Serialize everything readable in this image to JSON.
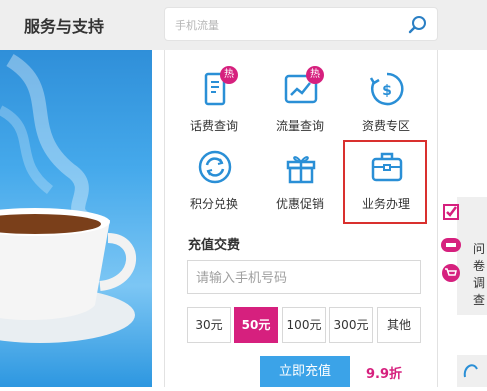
{
  "header": {
    "title": "服务与支持",
    "search_placeholder": "手机流量"
  },
  "services": [
    {
      "label": "话费查询",
      "badge": "热",
      "icon": "phone-bill-icon"
    },
    {
      "label": "流量查询",
      "badge": "热",
      "icon": "data-chart-icon"
    },
    {
      "label": "资费专区",
      "badge": "",
      "icon": "tariff-icon"
    },
    {
      "label": "积分兑换",
      "badge": "",
      "icon": "points-exchange-icon"
    },
    {
      "label": "优惠促销",
      "badge": "",
      "icon": "gift-icon"
    },
    {
      "label": "业务办理",
      "badge": "",
      "icon": "briefcase-icon"
    }
  ],
  "recharge": {
    "title": "充值交费",
    "phone_placeholder": "请输入手机号码",
    "amounts": [
      "30元",
      "50元",
      "100元",
      "300元",
      "其他"
    ],
    "selected": "50元",
    "submit_label": "立即充值",
    "discount": "9.9折"
  },
  "side_panel": {
    "text": "问卷调查"
  },
  "colors": {
    "accent": "#3ba3e8",
    "brand": "#d6207e",
    "highlight": "#d9302e"
  }
}
